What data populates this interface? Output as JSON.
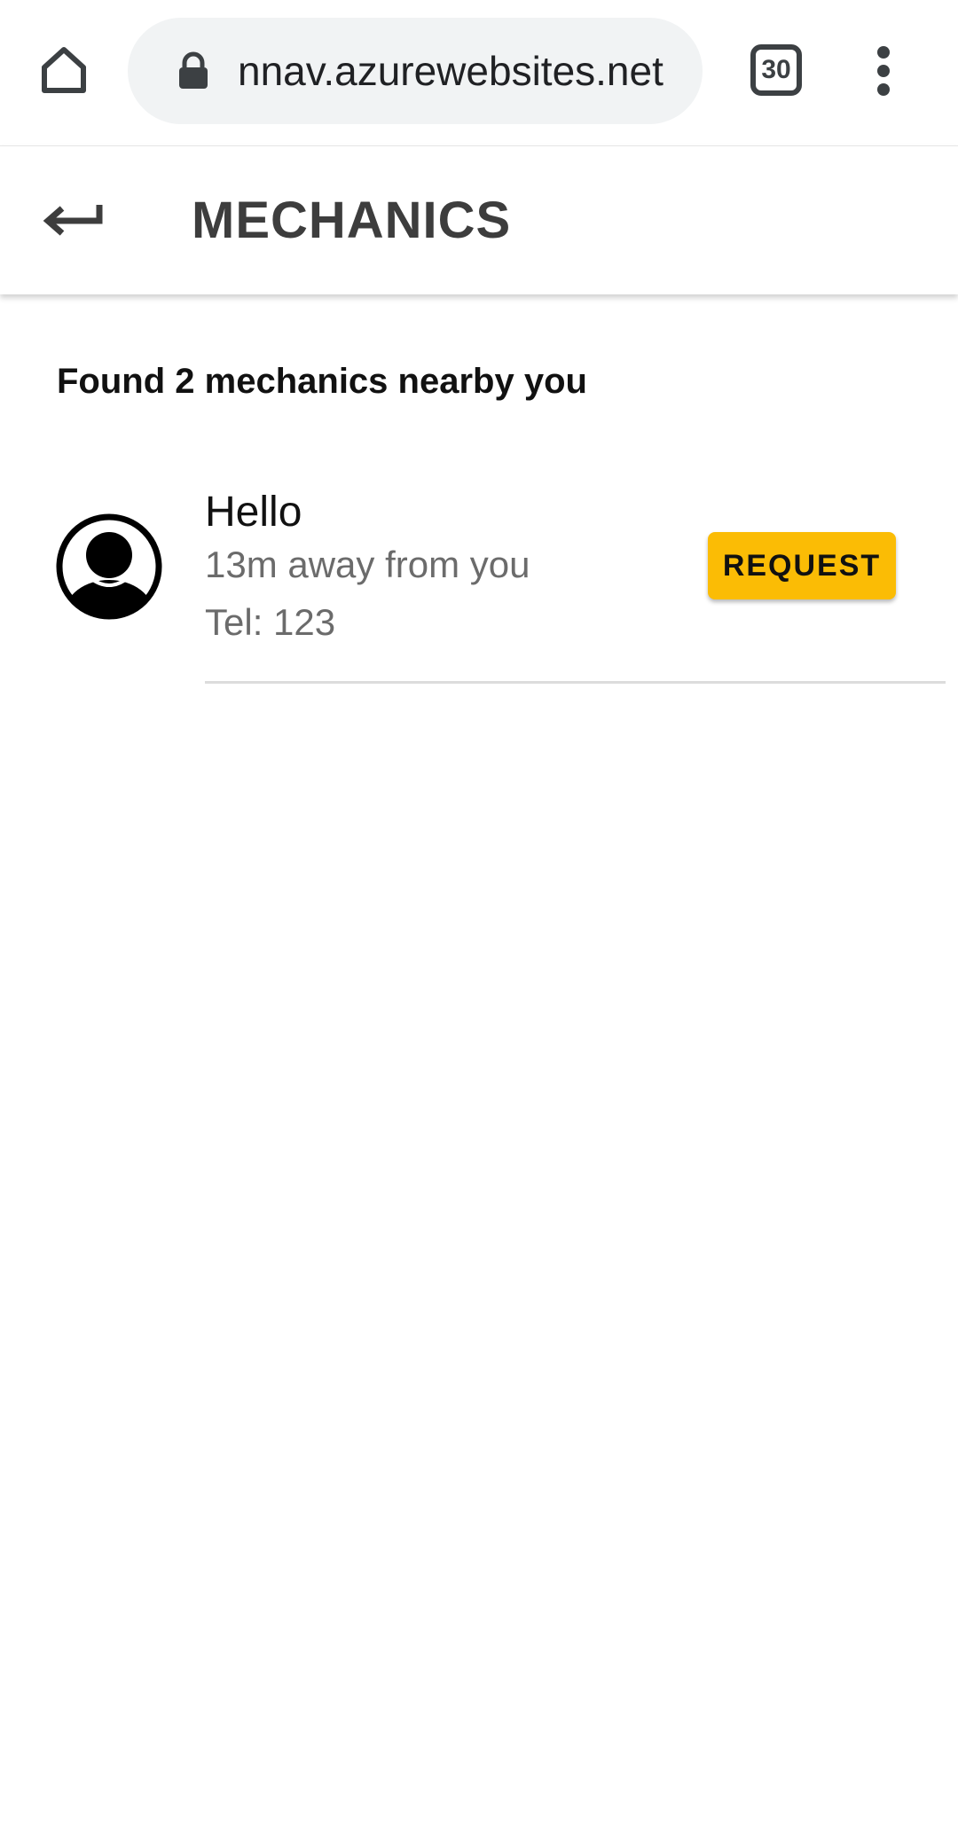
{
  "browser": {
    "url": "nnav.azurewebsites.net",
    "tab_count": "30",
    "icons": {
      "home": "home-icon",
      "lock": "lock-icon",
      "tabs": "tab-switcher-icon",
      "menu": "more-vert-icon"
    }
  },
  "header": {
    "title": "MECHANICS",
    "back_icon": "back-arrow-icon"
  },
  "content": {
    "found_text": "Found 2 mechanics nearby you",
    "mechanics": [
      {
        "name": "Hello",
        "distance": "13m away from you",
        "tel": "Tel: 123",
        "action_label": "REQUEST",
        "avatar_icon": "account-circle-icon"
      }
    ]
  },
  "colors": {
    "accent_button": "#fbbc05",
    "title_text": "#3d3d3d",
    "secondary_text": "#6b6b6b",
    "url_pill_bg": "#f1f3f4"
  }
}
